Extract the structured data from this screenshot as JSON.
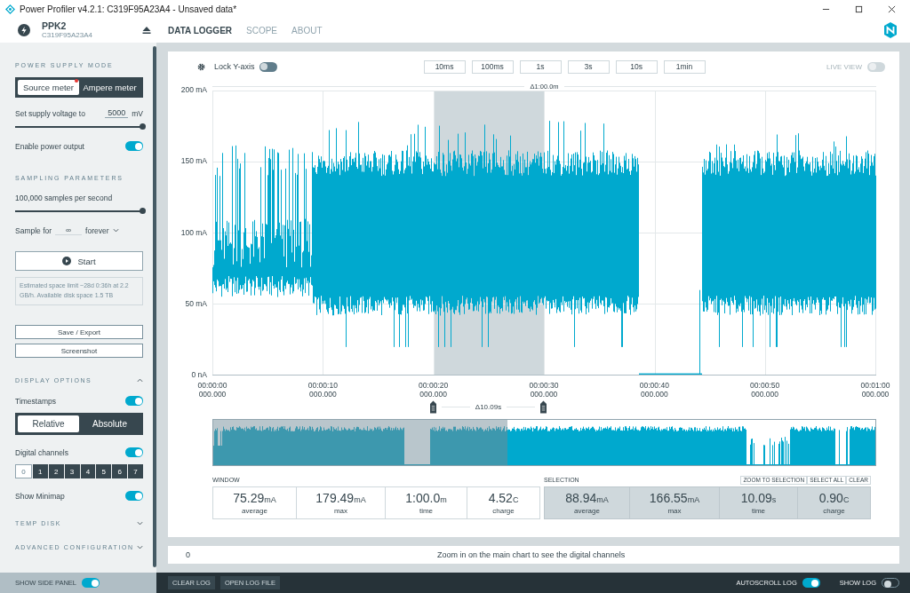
{
  "window": {
    "title": "Power Profiler v4.2.1: C319F95A23A4 - Unsaved data*"
  },
  "header": {
    "device_name": "PPK2",
    "serial": "C319F95A23A4",
    "tabs": [
      {
        "label": "DATA LOGGER",
        "selected": true
      },
      {
        "label": "SCOPE",
        "selected": false
      },
      {
        "label": "ABOUT",
        "selected": false
      }
    ]
  },
  "sidebar": {
    "power_supply": {
      "title": "POWER SUPPLY MODE",
      "modes": [
        {
          "label": "Source meter",
          "selected": true,
          "badge": true
        },
        {
          "label": "Ampere meter",
          "selected": false,
          "badge": false
        }
      ],
      "voltage": {
        "label": "Set supply voltage to",
        "value": "5000",
        "unit": "mV",
        "level": 1
      },
      "output": {
        "label": "Enable power output",
        "on": true
      }
    },
    "sampling": {
      "title": "SAMPLING PARAMETERS",
      "rate": {
        "label": "100,000 samples per second",
        "level": 1
      },
      "sample_for": {
        "label": "Sample for",
        "value": "∞",
        "unit": "forever"
      },
      "start_label": "Start",
      "info": "Estimated space limit ~28d 0:36h at 2.2 GB/h. Available disk space 1.5 TB"
    },
    "buttons": [
      "Save / Export",
      "Screenshot"
    ],
    "display_options": {
      "title": "DISPLAY OPTIONS",
      "expanded": true,
      "timestamps": {
        "label": "Timestamps",
        "on": true
      },
      "timestamp_modes": [
        {
          "label": "Relative",
          "selected": true
        },
        {
          "label": "Absolute",
          "selected": false
        }
      ],
      "digital_channels": {
        "label": "Digital channels",
        "on": true,
        "channels": [
          {
            "label": "0",
            "selected": true
          },
          {
            "label": "1",
            "selected": false
          },
          {
            "label": "2",
            "selected": false
          },
          {
            "label": "3",
            "selected": false
          },
          {
            "label": "4",
            "selected": false
          },
          {
            "label": "5",
            "selected": false
          },
          {
            "label": "6",
            "selected": false
          },
          {
            "label": "7",
            "selected": false
          }
        ]
      },
      "minimap": {
        "label": "Show Minimap",
        "on": true
      }
    },
    "collapsed_sections": [
      {
        "title": "TEMP DISK",
        "expanded": false
      },
      {
        "title": "ADVANCED CONFIGURATION",
        "expanded": false
      }
    ],
    "show_side_panel": {
      "label": "SHOW SIDE PANEL",
      "on": true
    }
  },
  "chart": {
    "lock_y_axis": {
      "label": "Lock Y-axis",
      "on": false
    },
    "zoom_buttons": [
      "10ms",
      "100ms",
      "1s",
      "3s",
      "10s",
      "1min"
    ],
    "live_view": {
      "label": "LIVE VIEW",
      "on": false,
      "disabled": true
    },
    "range_label": "Δ1:00.0m",
    "y_ticks": [
      "200 mA",
      "150 mA",
      "100 mA",
      "50 mA",
      "0 nA"
    ],
    "x_ticks": [
      {
        "time": "00:00:00",
        "ms": "000.000"
      },
      {
        "time": "00:00:10",
        "ms": "000.000"
      },
      {
        "time": "00:00:20",
        "ms": "000.000"
      },
      {
        "time": "00:00:30",
        "ms": "000.000"
      },
      {
        "time": "00:00:40",
        "ms": "000.000"
      },
      {
        "time": "00:00:50",
        "ms": "000.000"
      },
      {
        "time": "00:01:00",
        "ms": "000.000"
      }
    ],
    "selection_label": "Δ10.09s"
  },
  "stats": {
    "window": {
      "title": "WINDOW",
      "items": [
        {
          "value": "75.29",
          "unit": "mA",
          "label": "average"
        },
        {
          "value": "179.49",
          "unit": "mA",
          "label": "max"
        },
        {
          "value": "1:00.0",
          "unit": "m",
          "label": "time"
        },
        {
          "value": "4.52",
          "unit": "C",
          "label": "charge"
        }
      ]
    },
    "selection": {
      "title": "SELECTION",
      "actions": [
        "ZOOM TO SELECTION",
        "SELECT ALL",
        "CLEAR"
      ],
      "items": [
        {
          "value": "88.94",
          "unit": "mA",
          "label": "average"
        },
        {
          "value": "166.55",
          "unit": "mA",
          "label": "max"
        },
        {
          "value": "10.09",
          "unit": "s",
          "label": "time"
        },
        {
          "value": "0.90",
          "unit": "C",
          "label": "charge"
        }
      ]
    }
  },
  "digital_bar": {
    "channel": "0",
    "message": "Zoom in on the main chart to see the digital channels"
  },
  "footer": {
    "buttons": [
      "CLEAR LOG",
      "OPEN LOG FILE"
    ],
    "autoscroll": {
      "label": "AUTOSCROLL LOG",
      "on": true
    },
    "show_log": {
      "label": "SHOW LOG",
      "on": false
    }
  }
}
